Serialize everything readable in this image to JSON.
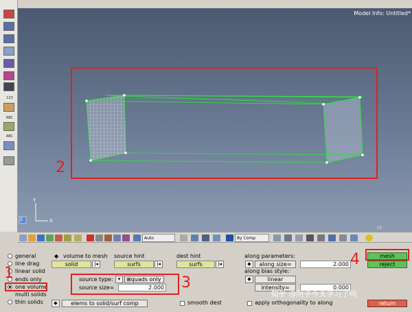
{
  "viewport": {
    "model_info": "Model Info: Untitled*",
    "axis_y": "Y",
    "axis_x": "X",
    "axis_z": "Z",
    "scale_number": "10"
  },
  "left_toolbar": {
    "labels": [
      "123",
      "ABC",
      "ABC"
    ]
  },
  "tool_strip": {
    "auto_label": "Auto",
    "by_comp_label": "By Comp"
  },
  "panel": {
    "radios": [
      {
        "label": "general",
        "selected": false
      },
      {
        "label": "line drag",
        "selected": false
      },
      {
        "label": "linear solid",
        "selected": false
      },
      {
        "label": "ends only",
        "selected": false
      },
      {
        "label": "one volume",
        "selected": true
      },
      {
        "label": "multi solids",
        "selected": false
      },
      {
        "label": "thin solids",
        "selected": false
      }
    ],
    "volume_to_mesh_label": "volume to mesh",
    "volume_to_mesh_value": "solid",
    "source_hint_label": "source hint",
    "source_hint_value": "surfs",
    "dest_hint_label": "dest hint",
    "dest_hint_value": "surfs",
    "source_type_label": "source type:",
    "source_type_value": "quads only",
    "source_size_label": "source size=",
    "source_size_value": "2.000",
    "elems_button": "elems to solid/surf comp",
    "smooth_dest_label": "smooth dest",
    "along_parameters_label": "along parameters:",
    "along_size_label": "along size=",
    "along_size_value": "2.000",
    "along_bias_label": "along bias style:",
    "bias_value": "linear",
    "intensity_label": "intensity=",
    "intensity_value": "0.000",
    "apply_orth_label": "apply orthogonality to along",
    "mesh_button": "mesh",
    "reject_button": "reject",
    "return_button": "return"
  },
  "annotations": {
    "n1": "1",
    "n2": "2",
    "n3": "3",
    "n4": "4"
  },
  "watermark": "知乎 @阿子今天学习了吗",
  "colors": {
    "annotation": "#e02020",
    "mesh_green": "#5fc15a",
    "return_red": "#d9614e",
    "field_yellow": "#dfe59a",
    "edge_green": "#38d64a"
  }
}
